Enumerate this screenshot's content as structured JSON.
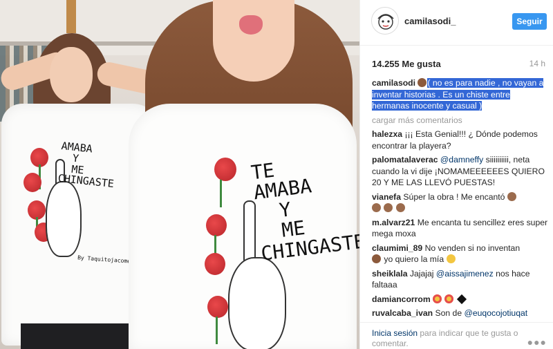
{
  "post": {
    "username": "camilasodi_",
    "follow_label": "Seguir",
    "likes": "14.255 Me gusta",
    "time_ago": "14 h",
    "load_more": "cargar más comentarios"
  },
  "photo": {
    "shirt_left_text": "AMABA\n  Y\n  ME\nCHINGASTE",
    "shirt_left_sign": "By Taquitojacome",
    "shirt_right_text": "TE\nAMABA\n  Y\n  ME\nCHINGASTE"
  },
  "caption": {
    "username": "camilasodi",
    "text": "( no es para nadie , no vayan a inventar historias . Es un chiste entre hermanas inocente y casual )"
  },
  "comments": [
    {
      "user": "halezxa",
      "text": "¡¡¡ Esta Genial!!! ¿ Dónde podemos encontrar la playera?"
    },
    {
      "user": "palomatalaverac",
      "mention": "@damneffy",
      "text": "siiiiiiiiii, neta cuando la vi dije ¡NOMAMEEEEEES QUIERO 20 Y ME LAS LLEVÓ PUESTAS!"
    },
    {
      "user": "vianefa",
      "text": "Súper la obra ! Me encantó"
    },
    {
      "user": "m.alvarz21",
      "text": "Me encanta tu sencillez eres super mega moxa"
    },
    {
      "user": "claumimi_89",
      "text": "No venden si no inventan",
      "text2": "yo quiero la mía"
    },
    {
      "user": "sheiklala",
      "text": "Jajajaj",
      "mention": "@aissajimenez",
      "text2": "nos hace faltaaa"
    },
    {
      "user": "damiancorrom",
      "text": ""
    },
    {
      "user": "ruvalcaba_ivan",
      "text": "Son de",
      "mention": "@euqocojotiuqat"
    }
  ],
  "footer": {
    "login_link": "Inicia sesión",
    "text": " para indicar que te gusta o comentar."
  },
  "icons": {
    "more": "more-options-icon"
  },
  "colors": {
    "accent": "#3897f0",
    "link": "#003569",
    "highlight": "#3367d6"
  }
}
